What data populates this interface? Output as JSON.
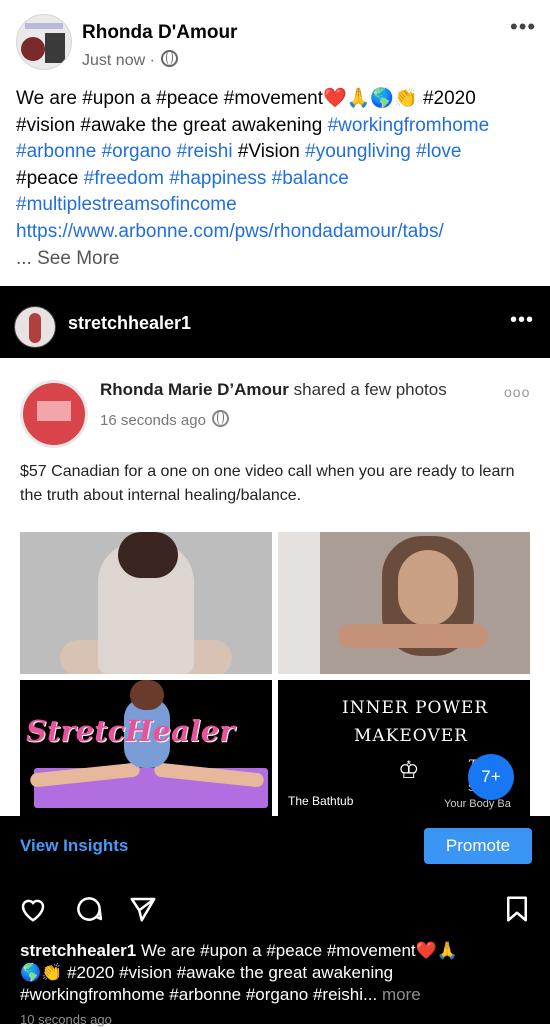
{
  "facebook": {
    "name": "Rhonda D'Amour",
    "time": "Just now ·",
    "post_line1_a": "We are ",
    "post_line1_b": "#upon a #peace #movement",
    "post_line1_emoji": "❤️🙏🌎👏",
    "post_line1_c": " #2020",
    "post_line2_a": "#vision #awake the great awakening ",
    "post_tag_workingfromhome": "#workingfromhome",
    "post_tag_arbonne": "#arbonne",
    "post_tag_organo": "#organo",
    "post_tag_reishi": "#reishi",
    "post_vision": "#Vision",
    "post_tag_youngliving": "#youngliving",
    "post_tag_love": "#love",
    "post_peace": "#peace",
    "post_tag_freedom": "#freedom",
    "post_tag_happiness": "#happiness",
    "post_tag_balance": "#balance",
    "post_tag_multiple": "#multiplestreamsofincome",
    "post_url": "https://www.arbonne.com/pws/rhondadamour/tabs/",
    "see_more": "... See More"
  },
  "instagram": {
    "username": "stretchhealer1",
    "shared": {
      "name": "Rhonda Marie D’Amour",
      "action": " shared a few photos",
      "time": "16 seconds ago",
      "text": "$57 Canadian for a one on one video call when you are ready to learn the truth about internal healing/balance."
    },
    "photos": {
      "title": "StretcHealer",
      "inner_power": "INNER POWER",
      "makeover": "MAKEOVER",
      "bathtub": "The Bathtub",
      "tail1": "The",
      "tail2": "Str",
      "tail3": "Your Body Ba",
      "more_badge": "7+"
    },
    "view_insights": "View Insights",
    "promote": "Promote",
    "caption_user": "stretchhealer1",
    "caption_a": " We are #upon a #peace #movement",
    "caption_emoji1": "❤️🙏",
    "caption_emoji2": "🌎👏",
    "caption_b": " #2020 #vision #awake the great awakening",
    "caption_c": "#workingfromhome #arbonne #organo #reishi...",
    "caption_more": " more",
    "time": "10 seconds ago"
  }
}
